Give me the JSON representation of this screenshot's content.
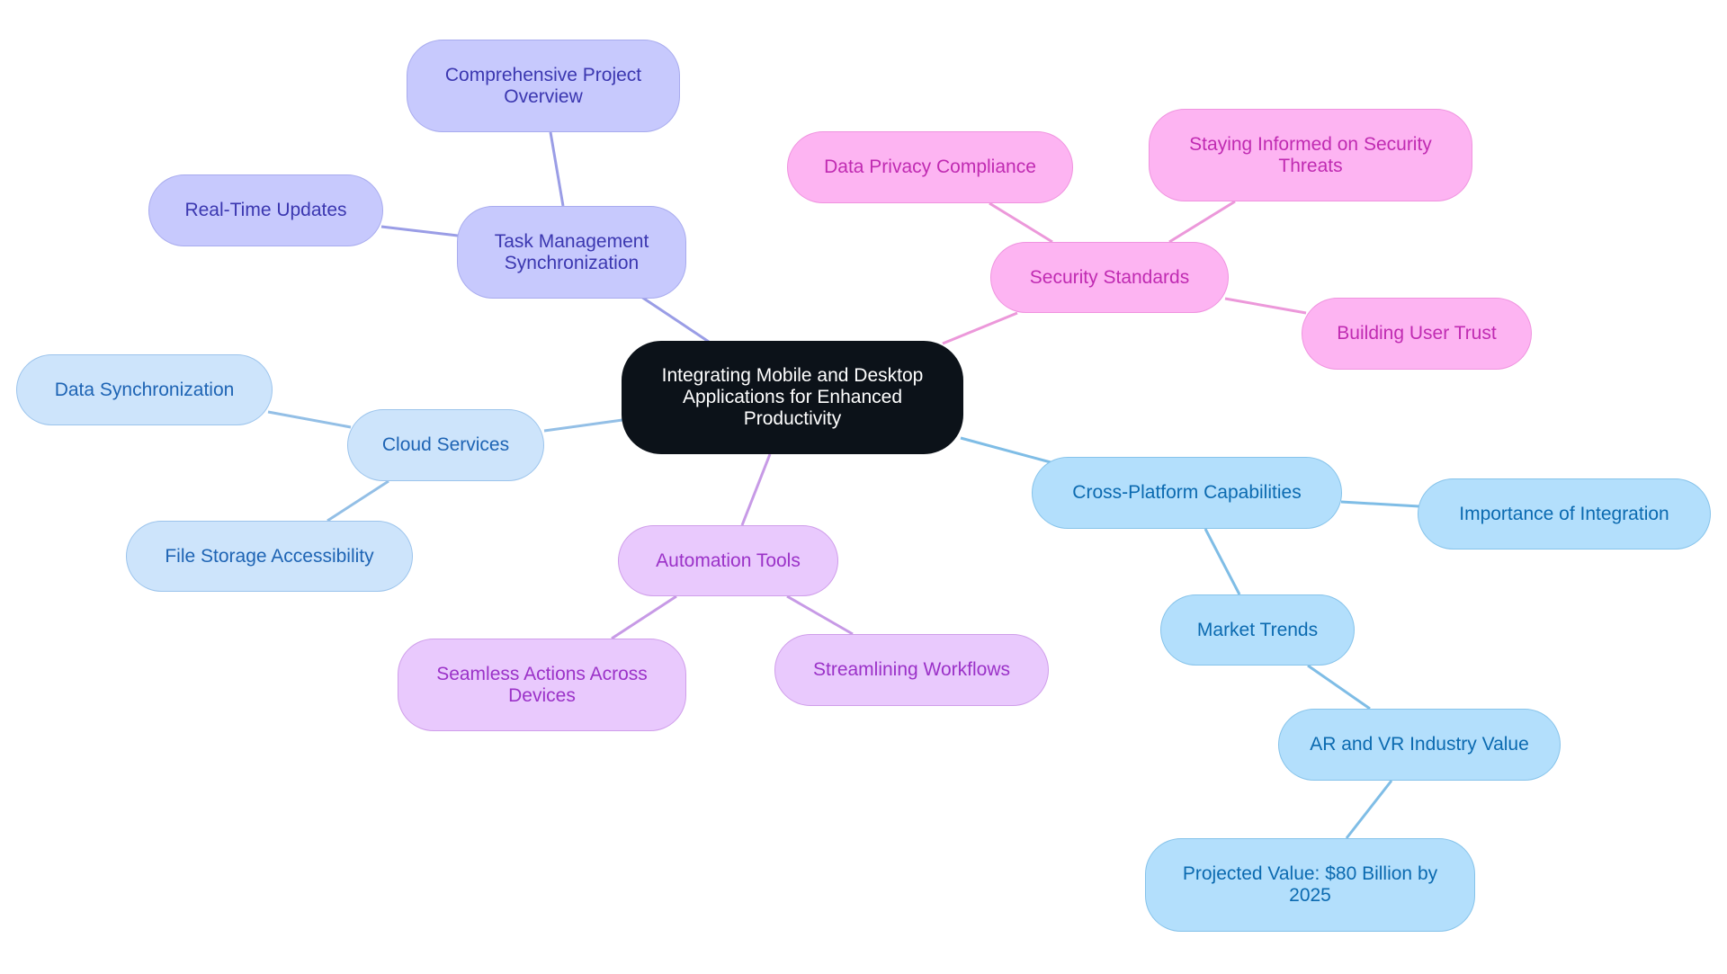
{
  "title": "Integrating Mobile and Desktop Applications for Enhanced Productivity",
  "colors": {
    "root": "#0c1219",
    "task_management": "#c7c9fd",
    "cloud_services": "#cde4fb",
    "automation_tools": "#e9c9fd",
    "security_standards": "#fdb4f2",
    "cross_platform": "#b3dffc"
  },
  "nodes": {
    "root": "Integrating Mobile and Desktop Applications for Enhanced Productivity",
    "task_management": "Task Management Synchronization",
    "project_overview": "Comprehensive Project Overview",
    "real_time_updates": "Real-Time Updates",
    "cloud_services": "Cloud Services",
    "data_sync": "Data Synchronization",
    "file_storage": "File Storage Accessibility",
    "automation_tools": "Automation Tools",
    "seamless_actions": "Seamless Actions Across Devices",
    "streamlining": "Streamlining Workflows",
    "security_standards": "Security Standards",
    "data_privacy": "Data Privacy Compliance",
    "staying_informed": "Staying Informed on Security Threats",
    "user_trust": "Building User Trust",
    "cross_platform": "Cross-Platform Capabilities",
    "importance_integration": "Importance of Integration",
    "market_trends": "Market Trends",
    "ar_vr_value": "AR and VR Industry Value",
    "projected_value": "Projected Value: $80 Billion by 2025"
  },
  "edges": [
    [
      "root",
      "task_management"
    ],
    [
      "task_management",
      "project_overview"
    ],
    [
      "task_management",
      "real_time_updates"
    ],
    [
      "root",
      "cloud_services"
    ],
    [
      "cloud_services",
      "data_sync"
    ],
    [
      "cloud_services",
      "file_storage"
    ],
    [
      "root",
      "automation_tools"
    ],
    [
      "automation_tools",
      "seamless_actions"
    ],
    [
      "automation_tools",
      "streamlining"
    ],
    [
      "root",
      "security_standards"
    ],
    [
      "security_standards",
      "data_privacy"
    ],
    [
      "security_standards",
      "staying_informed"
    ],
    [
      "security_standards",
      "user_trust"
    ],
    [
      "root",
      "cross_platform"
    ],
    [
      "cross_platform",
      "importance_integration"
    ],
    [
      "cross_platform",
      "market_trends"
    ],
    [
      "market_trends",
      "ar_vr_value"
    ],
    [
      "ar_vr_value",
      "projected_value"
    ]
  ]
}
